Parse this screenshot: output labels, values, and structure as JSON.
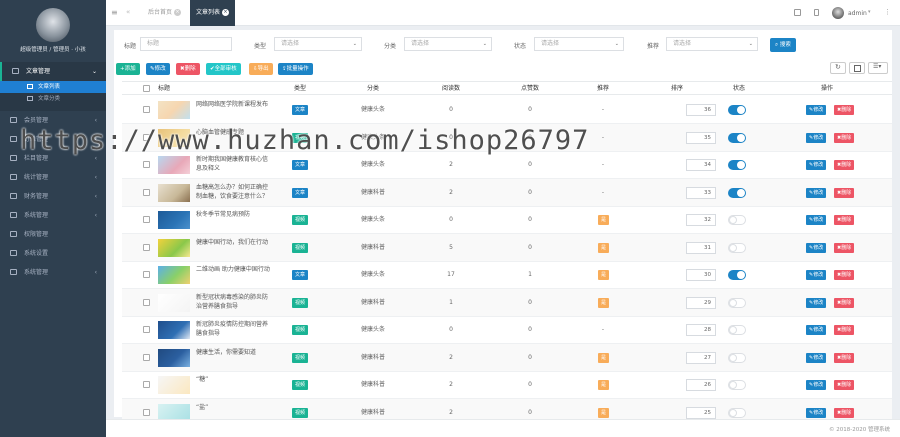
{
  "sidebar": {
    "user_name": "超级管理员 / 管理员 · 小孩",
    "menu": [
      {
        "label": "文章管理",
        "open": true,
        "children": [
          {
            "label": "文章列表",
            "active": true
          },
          {
            "label": "文章分类",
            "active": false
          }
        ]
      },
      {
        "label": "会员管理",
        "arrow": "‹"
      },
      {
        "label": "订单管理",
        "arrow": "‹"
      },
      {
        "label": "栏目管理",
        "arrow": "‹"
      },
      {
        "label": "统计管理",
        "arrow": "‹"
      },
      {
        "label": "财务管理",
        "arrow": "‹"
      },
      {
        "label": "系统管理",
        "arrow": "‹"
      },
      {
        "label": "权限管理",
        "arrow": ""
      },
      {
        "label": "系统设置",
        "arrow": ""
      },
      {
        "label": "系统管理",
        "arrow": "‹"
      }
    ]
  },
  "topbar": {
    "tabs": [
      {
        "label": "后台首页",
        "active": false
      },
      {
        "label": "文章列表",
        "active": true
      }
    ],
    "user": "admin"
  },
  "filters": {
    "title_label": "标题",
    "title_placeholder": "标题",
    "type_label": "类型",
    "type_value": "请选择",
    "category_label": "分类",
    "category_value": "请选择",
    "status_label": "状态",
    "status_value": "请选择",
    "recommend_label": "推荐",
    "recommend_value": "请选择",
    "search_btn": "搜索"
  },
  "toolbar": {
    "add": "添加",
    "edit": "修改",
    "delete": "删除",
    "audit": "全部审核",
    "export": "导出",
    "batch": "批量操作"
  },
  "table": {
    "headers": [
      "标题",
      "类型",
      "分类",
      "阅读数",
      "点赞数",
      "推荐",
      "排序",
      "状态",
      "操作"
    ],
    "rows": [
      {
        "title": "网络网络医学院新课程发布",
        "type": "文章",
        "category": "健康头条",
        "reads": "0",
        "likes": "0",
        "rec": "-",
        "sort": "36",
        "status": true
      },
      {
        "title": "心脑血管健康专题",
        "type": "视频",
        "category": "健康头条",
        "reads": "0",
        "likes": "0",
        "rec": "-",
        "sort": "35",
        "status": true
      },
      {
        "title": "新时期我国健康教育核心信息及释义",
        "type": "文章",
        "category": "健康头条",
        "reads": "2",
        "likes": "0",
        "rec": "-",
        "sort": "34",
        "status": true
      },
      {
        "title": "血糖高怎么办？如何正确控制血糖，饮食要注意什么？",
        "type": "文章",
        "category": "健康科普",
        "reads": "2",
        "likes": "0",
        "rec": "-",
        "sort": "33",
        "status": true
      },
      {
        "title": "秋冬季节常见病预防",
        "type": "视频",
        "category": "健康头条",
        "reads": "0",
        "likes": "0",
        "rec": "是",
        "sort": "32",
        "status": false
      },
      {
        "title": "健康中国行动，我们在行动",
        "type": "视频",
        "category": "健康科普",
        "reads": "5",
        "likes": "0",
        "rec": "是",
        "sort": "31",
        "status": false
      },
      {
        "title": "二维动画 助力健康中国行动",
        "type": "文章",
        "category": "健康头条",
        "reads": "17",
        "likes": "1",
        "rec": "是",
        "sort": "30",
        "status": true
      },
      {
        "title": "新型冠状病毒感染的肺炎防治营养膳食指导",
        "type": "视频",
        "category": "健康科普",
        "reads": "1",
        "likes": "0",
        "rec": "是",
        "sort": "29",
        "status": false
      },
      {
        "title": "新冠肺炎疫情防控期间营养膳食指导",
        "type": "视频",
        "category": "健康头条",
        "reads": "0",
        "likes": "0",
        "rec": "-",
        "sort": "28",
        "status": false
      },
      {
        "title": "健康生活，你需要知道",
        "type": "视频",
        "category": "健康科普",
        "reads": "2",
        "likes": "0",
        "rec": "是",
        "sort": "27",
        "status": false
      },
      {
        "title": "“糖”",
        "type": "视频",
        "category": "健康科普",
        "reads": "2",
        "likes": "0",
        "rec": "是",
        "sort": "26",
        "status": false
      },
      {
        "title": "“盐”",
        "type": "视频",
        "category": "健康科普",
        "reads": "2",
        "likes": "0",
        "rec": "是",
        "sort": "25",
        "status": false
      }
    ],
    "edit_label": "修改",
    "delete_label": "删除"
  },
  "footer": {
    "copyright": "© 2018-2020 管理系统"
  },
  "watermark": "https://www.huzhan.com/ishop26797",
  "colors": {
    "sidebar": "#2f4050",
    "primary": "#1c84c6",
    "add": "#1ab394",
    "danger": "#ed5565",
    "warning": "#f8ac59",
    "info": "#23c6c8",
    "article_badge": "#1c84c6",
    "video_badge": "#1ab394"
  }
}
